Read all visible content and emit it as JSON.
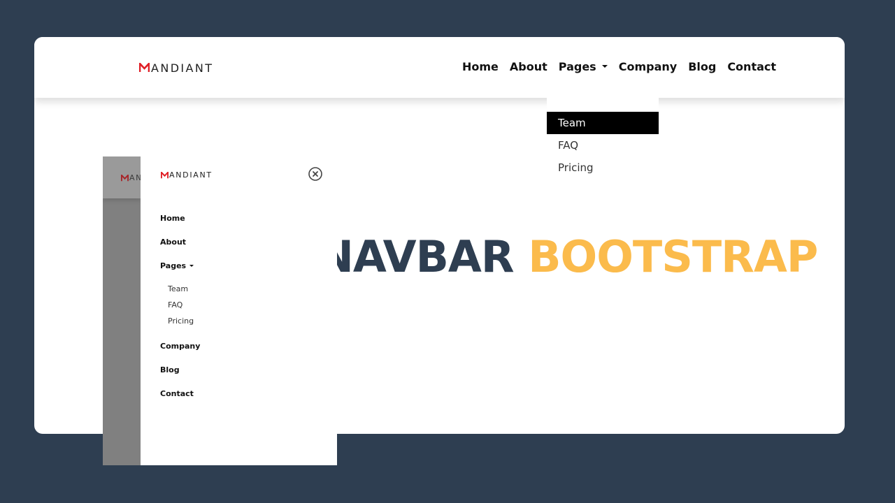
{
  "brand": {
    "logo_text": "MANDIANT",
    "mark_letter": "M",
    "rest_text": "ANDIANT",
    "colors": {
      "mark": "#e01f26",
      "text": "#222222"
    }
  },
  "navbar": {
    "items": [
      {
        "label": "Home"
      },
      {
        "label": "About"
      },
      {
        "label": "Pages",
        "has_dropdown": true,
        "icon": "caret-down-icon"
      },
      {
        "label": "Company"
      },
      {
        "label": "Blog"
      },
      {
        "label": "Contact"
      }
    ]
  },
  "dropdown": {
    "items": [
      {
        "label": "Team",
        "active": true
      },
      {
        "label": "FAQ"
      },
      {
        "label": "Pricing"
      }
    ]
  },
  "hero": {
    "part1": "NAVBAR",
    "part2": "BOOTSTRAP",
    "colors": {
      "part1": "#2e3e51",
      "part2": "#fbbb4c"
    }
  },
  "mobile": {
    "background_brand_visible": "MA",
    "close_icon": "close-circle-icon",
    "items": [
      {
        "label": "Home"
      },
      {
        "label": "About"
      },
      {
        "label": "Pages",
        "has_dropdown": true
      },
      {
        "label": "Company"
      },
      {
        "label": "Blog"
      },
      {
        "label": "Contact"
      }
    ],
    "subitems": [
      {
        "label": "Team"
      },
      {
        "label": "FAQ"
      },
      {
        "label": "Pricing"
      }
    ]
  },
  "theme": {
    "page_background": "#2e3e51",
    "card_background": "#ffffff",
    "active_item_background": "#000000",
    "overlay_gray": "#808080"
  }
}
